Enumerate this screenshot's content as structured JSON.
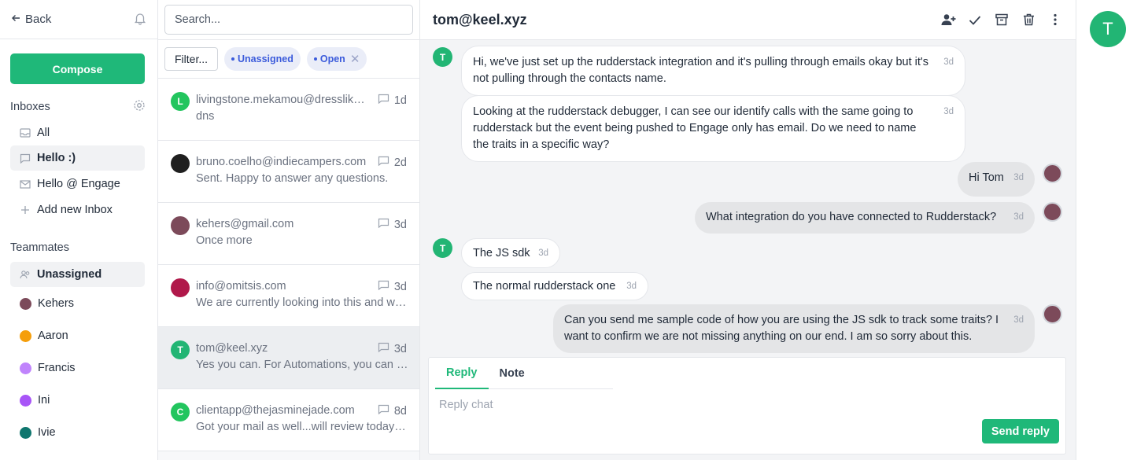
{
  "sidebar": {
    "back_label": "Back",
    "compose_label": "Compose",
    "inboxes_title": "Inboxes",
    "inboxes": [
      {
        "label": "All",
        "icon": "inbox-icon"
      },
      {
        "label": "Hello :)",
        "icon": "chat-icon",
        "active": true
      },
      {
        "label": "Hello @ Engage",
        "icon": "mail-icon"
      },
      {
        "label": "Add new Inbox",
        "icon": "plus-icon"
      }
    ],
    "teammates_title": "Teammates",
    "teammates": [
      {
        "label": "Unassigned",
        "color": "#9ca3af",
        "active": true
      },
      {
        "label": "Kehers",
        "color": "#7c4a5a"
      },
      {
        "label": "Aaron",
        "color": "#f59e0b"
      },
      {
        "label": "Francis",
        "color": "#c084fc"
      },
      {
        "label": "Ini",
        "color": "#a855f7"
      },
      {
        "label": "Ivie",
        "color": "#0f766e"
      }
    ]
  },
  "list": {
    "search_placeholder": "Search...",
    "filter_label": "Filter...",
    "chips": [
      "Unassigned",
      "Open"
    ],
    "conversations": [
      {
        "from": "livingstone.mekamou@dresslikeme.com",
        "preview": "dns",
        "time": "1d",
        "avatar": "L",
        "color": "#22c55e"
      },
      {
        "from": "bruno.coelho@indiecampers.com",
        "preview": "Sent. Happy to answer any questions.",
        "time": "2d",
        "avatar": "",
        "color": "#1f1f1f"
      },
      {
        "from": "kehers@gmail.com",
        "preview": "Once more",
        "time": "3d",
        "avatar": "",
        "color": "#7c4a5a"
      },
      {
        "from": "info@omitsis.com",
        "preview": "We are currently looking into this and will get back",
        "time": "3d",
        "avatar": "",
        "color": "#b0184a"
      },
      {
        "from": "tom@keel.xyz",
        "preview": "Yes you can. For Automations, you can use the API",
        "time": "3d",
        "avatar": "T",
        "color": "#22b574",
        "selected": true
      },
      {
        "from": "clientapp@thejasminejade.com",
        "preview": "Got your mail as well...will review today and revert",
        "time": "8d",
        "avatar": "C",
        "color": "#22c55e"
      }
    ]
  },
  "chat": {
    "title": "tom@keel.xyz",
    "messages": [
      {
        "text": "Hi, we've just set up the rudderstack integration and it's pulling through emails okay but it's not pulling through the contacts name.",
        "time": "3d"
      },
      {
        "text": "Looking at the rudderstack debugger, I can see our identify calls with the same going to rudderstack but the event being pushed to Engage only has email. Do we need to name the traits in a specific way?",
        "time": "3d"
      },
      {
        "text": "Hi Tom",
        "time": "3d"
      },
      {
        "text": "What integration do you have connected to Rudderstack?",
        "time": "3d"
      },
      {
        "text": "The JS sdk",
        "time": "3d"
      },
      {
        "text": "The normal rudderstack one",
        "time": "3d"
      },
      {
        "text": "Can you send me sample code of how you are using the JS sdk to track some traits? I want to confirm we are not missing anything on our end. I am so sorry about this.",
        "time": "3d"
      }
    ],
    "contact_initial": "T",
    "tabs": [
      "Reply",
      "Note"
    ],
    "reply_placeholder": "Reply chat",
    "send_label": "Send reply"
  },
  "rail": {
    "avatar": "T"
  },
  "colors": {
    "accent": "#1fb879",
    "chip": "#3b5bdb"
  }
}
